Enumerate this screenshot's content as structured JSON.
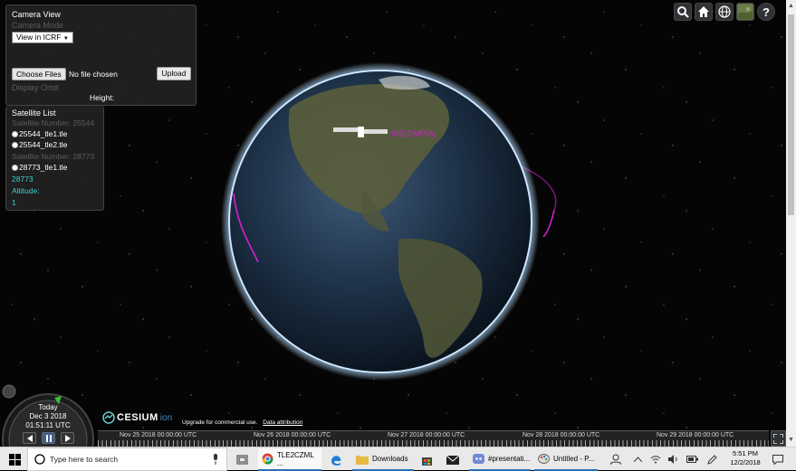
{
  "camera_panel": {
    "title": "Camera View",
    "ghost_camera_mode": "Camera Mode",
    "select_value": "View in ICRF",
    "choose_files_label": "Choose Files",
    "no_file_text": "No file chosen",
    "upload_label": "Upload",
    "ghost_display_orbit": "Display Orbit",
    "height_label": "Height:"
  },
  "satellite_list": {
    "title": "Satellite List",
    "groups": [
      {
        "ghost_header": "Satellite Number: 25544",
        "items": [
          "25544_tle1.tle",
          "25544_tle2.tle"
        ]
      },
      {
        "ghost_header": "Satellite Number: 28773",
        "items": [
          "28773_tle1.tle"
        ]
      }
    ],
    "selected_number": "28773",
    "altitude_label": "Altitude:",
    "altitude_value": "1"
  },
  "satellite_label": "ISS(ZARYA)",
  "toolbar": {
    "buttons": [
      "search-icon",
      "home-icon",
      "globe-icon",
      "imagery-icon",
      "help-icon"
    ],
    "help_glyph": "?"
  },
  "animation": {
    "day": "Today",
    "date": "Dec 3 2018",
    "time": "01:51:11 UTC"
  },
  "cesium": {
    "logo_text": "CESIUM",
    "ion_text": "ion",
    "credit_text": "Upgrade for commercial use.",
    "attribution_text": "Data attribution"
  },
  "timeline": {
    "labels": [
      "Nov 25 2018 00:00:00 UTC",
      "Nov 26 2018 00:00:00 UTC",
      "Nov 27 2018 00:00:00 UTC",
      "Nov 28 2018 00:00:00 UTC",
      "Nov 29 2018 00:00:00 UTC"
    ]
  },
  "taskbar": {
    "search_placeholder": "Type here to search",
    "apps": [
      {
        "label": "TLE2CZML ...",
        "icon": "chrome-icon"
      },
      {
        "label": "",
        "icon": "edge-icon"
      },
      {
        "label": "Downloads",
        "icon": "folder-icon"
      },
      {
        "label": "",
        "icon": "store-icon"
      },
      {
        "label": "",
        "icon": "mail-icon"
      },
      {
        "label": "#presentati...",
        "icon": "discord-icon"
      },
      {
        "label": "Untitled - P...",
        "icon": "paint-icon"
      }
    ],
    "time": "5:51 PM",
    "date": "12/2/2018"
  },
  "colors": {
    "orbit": "#d21fd2",
    "accent_cyan": "#3fd0d0",
    "taskbar_accent": "#2a6fb8"
  }
}
